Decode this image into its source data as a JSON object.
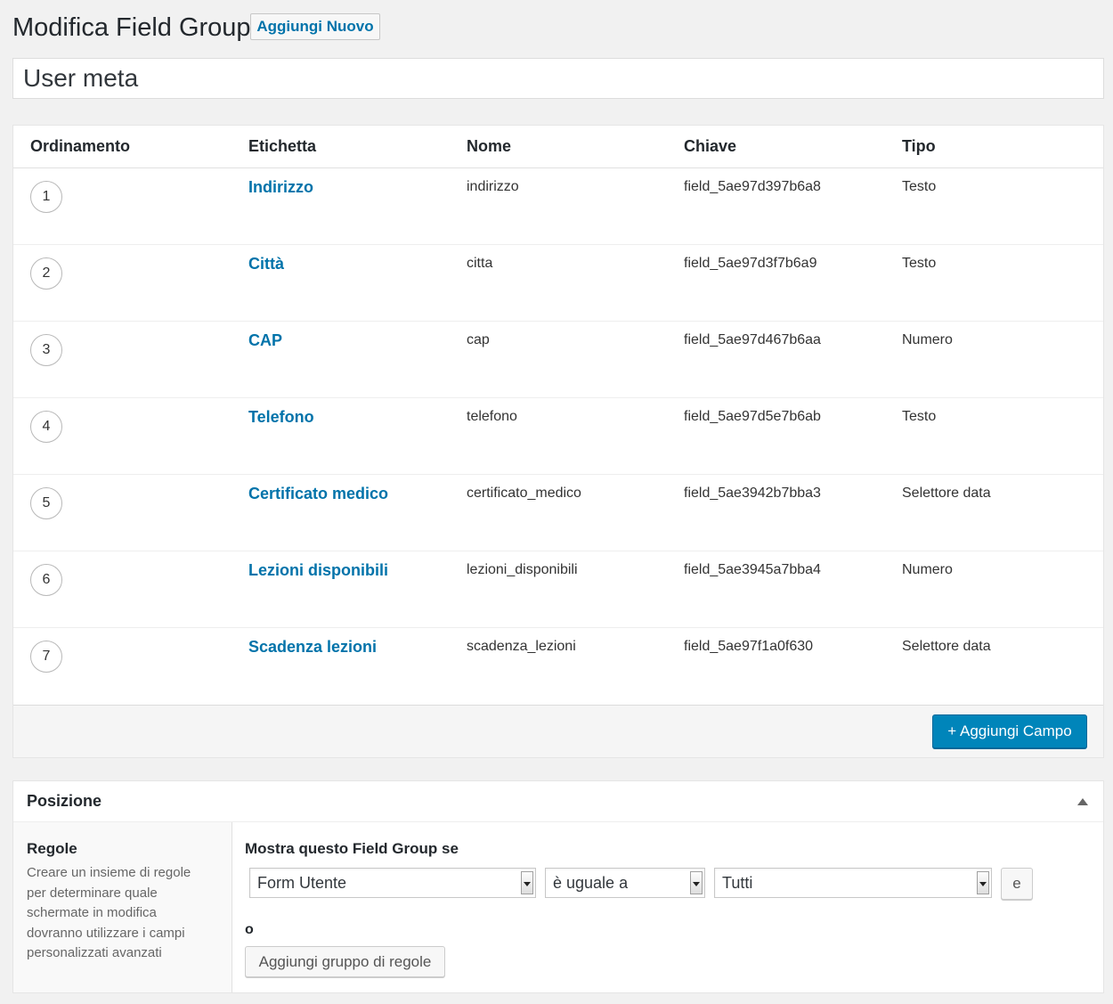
{
  "header": {
    "title": "Modifica Field Group",
    "add_new_label": "Aggiungi Nuovo"
  },
  "group_title": "User meta",
  "fields_table": {
    "columns": [
      "Ordinamento",
      "Etichetta",
      "Nome",
      "Chiave",
      "Tipo"
    ],
    "rows": [
      {
        "order": "1",
        "label": "Indirizzo",
        "name": "indirizzo",
        "key": "field_5ae97d397b6a8",
        "type": "Testo"
      },
      {
        "order": "2",
        "label": "Città",
        "name": "citta",
        "key": "field_5ae97d3f7b6a9",
        "type": "Testo"
      },
      {
        "order": "3",
        "label": "CAP",
        "name": "cap",
        "key": "field_5ae97d467b6aa",
        "type": "Numero"
      },
      {
        "order": "4",
        "label": "Telefono",
        "name": "telefono",
        "key": "field_5ae97d5e7b6ab",
        "type": "Testo"
      },
      {
        "order": "5",
        "label": "Certificato medico",
        "name": "certificato_medico",
        "key": "field_5ae3942b7bba3",
        "type": "Selettore data"
      },
      {
        "order": "6",
        "label": "Lezioni disponibili",
        "name": "lezioni_disponibili",
        "key": "field_5ae3945a7bba4",
        "type": "Numero"
      },
      {
        "order": "7",
        "label": "Scadenza lezioni",
        "name": "scadenza_lezioni",
        "key": "field_5ae97f1a0f630",
        "type": "Selettore data"
      }
    ],
    "add_field_label": "+ Aggiungi Campo"
  },
  "location": {
    "title": "Posizione",
    "toggle_icon": "triangle-up-icon",
    "rules_title": "Regole",
    "rules_description": "Creare un insieme di regole per determinare quale schermate in modifica dovranno utilizzare i campi personalizzati avanzati",
    "show_if_label": "Mostra questo Field Group se",
    "param_value": "Form Utente",
    "operator_value": "è uguale a",
    "value_value": "Tutti",
    "and_label": "e",
    "or_label": "o",
    "add_group_label": "Aggiungi gruppo di regole"
  },
  "colors": {
    "link": "#0073aa",
    "primary_button": "#0085ba",
    "background": "#f1f1f1"
  }
}
